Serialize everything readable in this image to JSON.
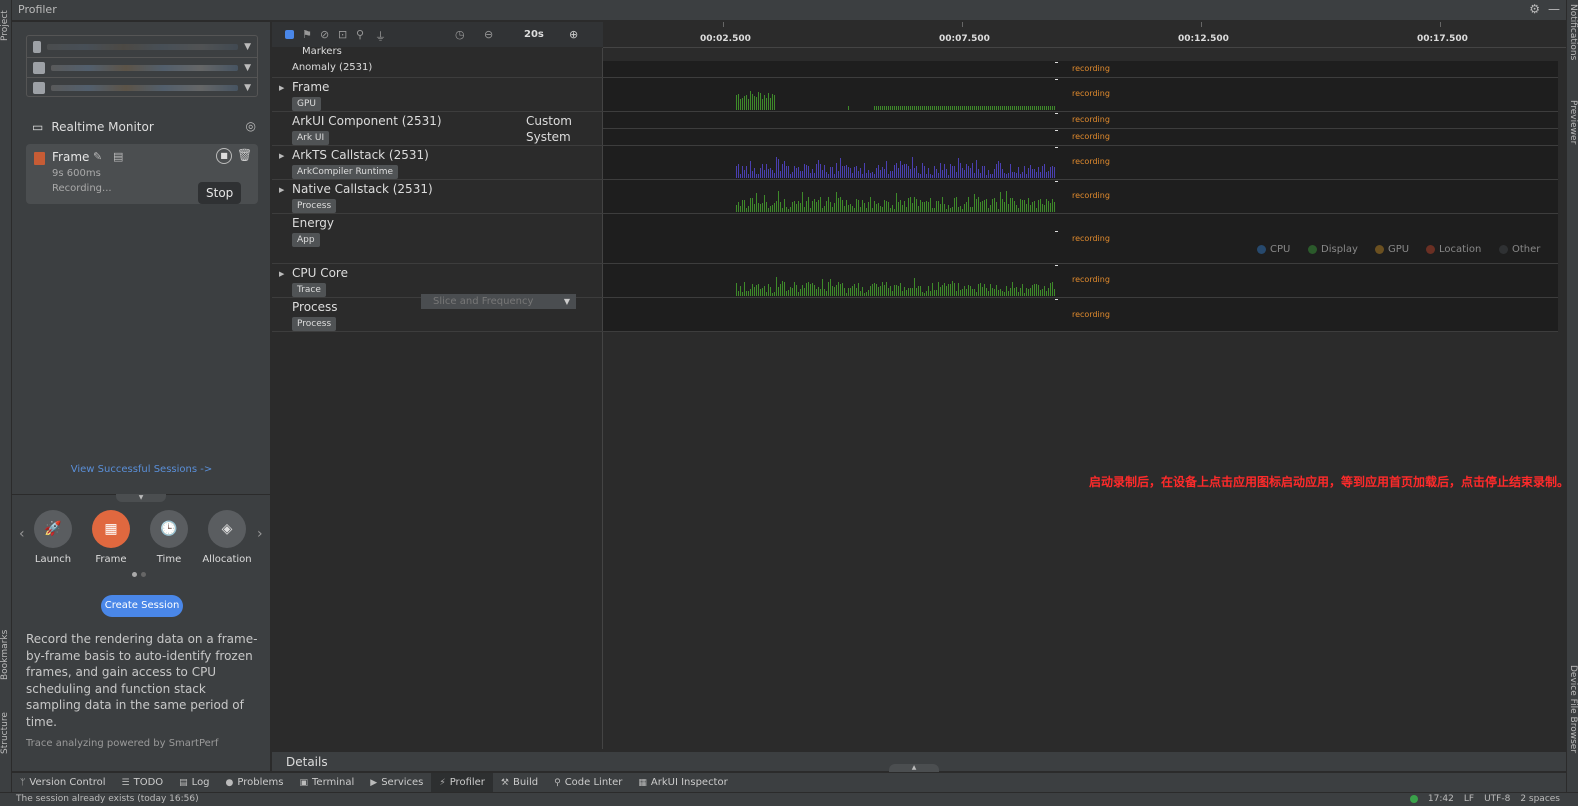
{
  "window": {
    "title": "Profiler"
  },
  "left_strip": {
    "project": "Project",
    "bookmarks": "Bookmarks",
    "structure": "Structure"
  },
  "right_strip": {
    "notifications": "Notifications",
    "previewer": "Previewer",
    "device_file_browser": "Device File Browser"
  },
  "sidebar": {
    "realtime_monitor": "Realtime Monitor",
    "session": {
      "name": "Frame",
      "duration": "9s 600ms",
      "status": "Recording..."
    },
    "tooltip": "Stop",
    "view_sessions": "View Successful Sessions ->",
    "tasks": [
      {
        "label": "Launch",
        "icon": "rocket-icon",
        "glyph": "🚀"
      },
      {
        "label": "Frame",
        "icon": "frame-icon",
        "glyph": "▦"
      },
      {
        "label": "Time",
        "icon": "clock-icon",
        "glyph": "🕒"
      },
      {
        "label": "Allocation",
        "icon": "cube-icon",
        "glyph": "◈"
      }
    ],
    "create_session": "Create Session",
    "description": "Record the rendering data on a frame-by-frame basis to auto-identify frozen frames, and gain access to CPU scheduling and function stack sampling data in the same period of time.",
    "powered_by": "Trace analyzing powered by SmartPerf"
  },
  "toolbar": {
    "zoom": "20s"
  },
  "timeline": {
    "ticks": [
      "00:02.500",
      "00:07.500",
      "00:12.500",
      "00:17.500"
    ]
  },
  "tracks": [
    {
      "name": "Markers"
    },
    {
      "name": "Anomaly (2531)",
      "status": "recording"
    },
    {
      "name": "Frame",
      "tag": "GPU",
      "status": "recording",
      "color": "#3e8a2a"
    },
    {
      "name": "ArkUI Component (2531)",
      "tag": "Ark UI",
      "extra1": "Custom",
      "extra2": "System",
      "status1": "recording",
      "status2": "recording"
    },
    {
      "name": "ArkTS Callstack (2531)",
      "tag": "ArkCompiler Runtime",
      "status": "recording",
      "color": "#4a3fb0"
    },
    {
      "name": "Native Callstack (2531)",
      "tag": "Process",
      "status": "recording",
      "color": "#3e8a2a"
    },
    {
      "name": "Energy",
      "tag": "App",
      "status": "recording"
    },
    {
      "name": "CPU Core",
      "tag": "Trace",
      "status": "recording",
      "color": "#3e8a2a",
      "dropdown": "Slice and Frequency"
    },
    {
      "name": "Process",
      "tag": "Process",
      "status": "recording"
    }
  ],
  "energy_legend": [
    {
      "label": "CPU",
      "color": "#27496d"
    },
    {
      "label": "Display",
      "color": "#2b5a2b"
    },
    {
      "label": "GPU",
      "color": "#6b5020"
    },
    {
      "label": "Location",
      "color": "#6a2f23"
    },
    {
      "label": "Other",
      "color": "#2f3133"
    }
  ],
  "annotation": "启动录制后，在设备上点击应用图标启动应用，等到应用首页加载后，点击停止结束录制。",
  "details": {
    "label": "Details"
  },
  "bottom_tabs": [
    {
      "label": "Version Control",
      "icon": "branch-icon",
      "glyph": "ᛘ"
    },
    {
      "label": "TODO",
      "icon": "list-icon",
      "glyph": "☰"
    },
    {
      "label": "Log",
      "icon": "log-icon",
      "glyph": "▤"
    },
    {
      "label": "Problems",
      "icon": "problems-icon",
      "glyph": "●"
    },
    {
      "label": "Terminal",
      "icon": "terminal-icon",
      "glyph": "▣"
    },
    {
      "label": "Services",
      "icon": "services-icon",
      "glyph": "▶"
    },
    {
      "label": "Profiler",
      "icon": "profiler-icon",
      "glyph": "⚡",
      "active": true
    },
    {
      "label": "Build",
      "icon": "hammer-icon",
      "glyph": "⚒"
    },
    {
      "label": "Code Linter",
      "icon": "linter-icon",
      "glyph": "⚲"
    },
    {
      "label": "ArkUI Inspector",
      "icon": "inspector-icon",
      "glyph": "▦"
    }
  ],
  "status_bar": {
    "message": "The session already exists (today 16:56)",
    "time": "17:42",
    "line_sep": "LF",
    "encoding": "UTF-8",
    "indent": "2 spaces"
  }
}
